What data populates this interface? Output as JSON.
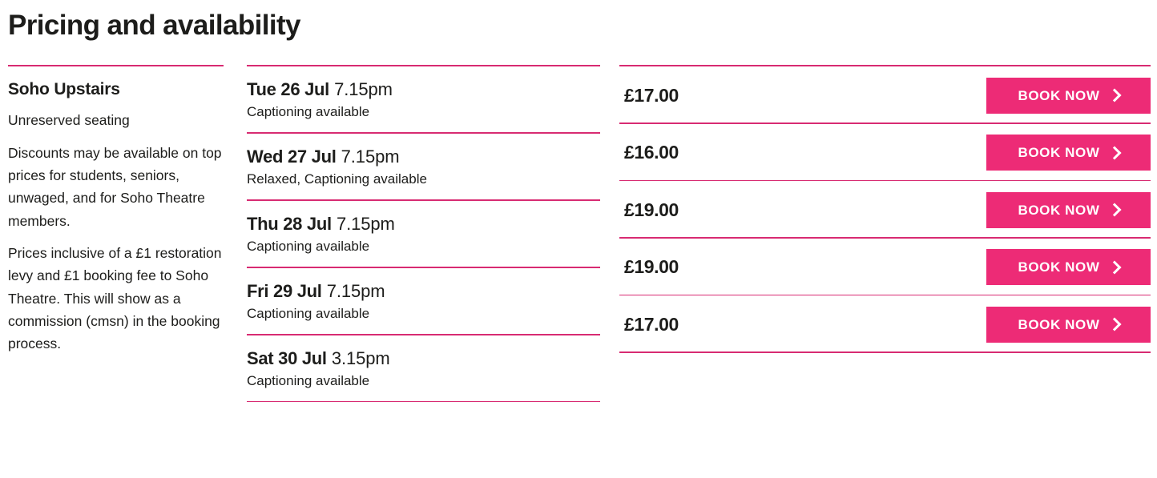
{
  "page_title": "Pricing and availability",
  "theme": {
    "accent": "#ed2b76",
    "rule": "#d82b72",
    "text": "#1d1d1b",
    "button_text": "#ffffff",
    "background": "#ffffff"
  },
  "venue": {
    "name": "Soho Upstairs",
    "paragraphs": [
      "Unreserved seating",
      "Discounts may be available on top prices for students, seniors, unwaged, and for Soho Theatre members.",
      "Prices inclusive of a £1 restoration levy and £1 booking fee to Soho Theatre. This will show as a commission (cmsn) in the booking process."
    ]
  },
  "book_button": {
    "label": "BOOK NOW",
    "icon": "chevron-right-icon"
  },
  "performances": [
    {
      "date": "Tue 26 Jul",
      "time": "7.15pm",
      "note": "Captioning available",
      "price": "£17.00"
    },
    {
      "date": "Wed 27 Jul",
      "time": "7.15pm",
      "note": "Relaxed, Captioning available",
      "price": "£16.00"
    },
    {
      "date": "Thu 28 Jul",
      "time": "7.15pm",
      "note": "Captioning available",
      "price": "£19.00"
    },
    {
      "date": "Fri 29 Jul",
      "time": "7.15pm",
      "note": "Captioning available",
      "price": "£19.00"
    },
    {
      "date": "Sat 30 Jul",
      "time": "3.15pm",
      "note": "Captioning available",
      "price": "£17.00"
    }
  ]
}
